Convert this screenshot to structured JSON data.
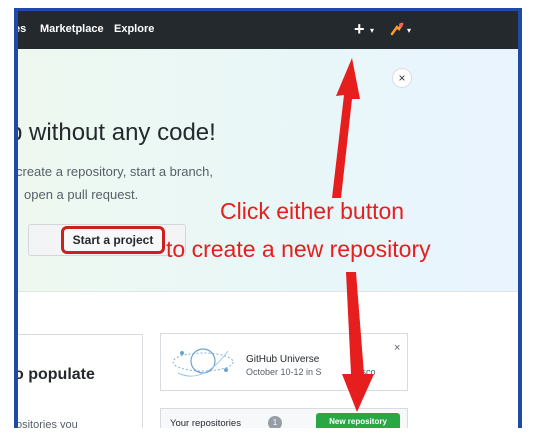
{
  "navbar": {
    "items": [
      "es",
      "Marketplace",
      "Explore"
    ],
    "plus_label": "+"
  },
  "hero": {
    "close_glyph": "×",
    "title": "p without any code!",
    "subtitle_line1": "create a repository, start a branch,",
    "subtitle_line2": "open a pull request.",
    "start_button": "Start a project"
  },
  "dashboard": {
    "populate_heading": "o populate",
    "repos_text": "ositories you",
    "universe_title": "GitHub Universe",
    "universe_date": "October 10-12 in S",
    "universe_date_tail": "sco",
    "universe_close": "×",
    "repos_header": "Your repositories",
    "repo_count": "1",
    "new_repo_button": "New repository"
  },
  "annotation": {
    "line1": "Click either button",
    "line2": "to create a new repository",
    "color": "#e61e1e"
  },
  "colors": {
    "navbar": "#24292e",
    "green_button": "#28a745",
    "highlight_border": "#cc1f1f",
    "frame_border": "#1f4aa6"
  },
  "icons": [
    "plus-icon",
    "caret-down-icon",
    "avatar-icon",
    "close-icon",
    "octocat-logo-icon",
    "question-icon"
  ]
}
